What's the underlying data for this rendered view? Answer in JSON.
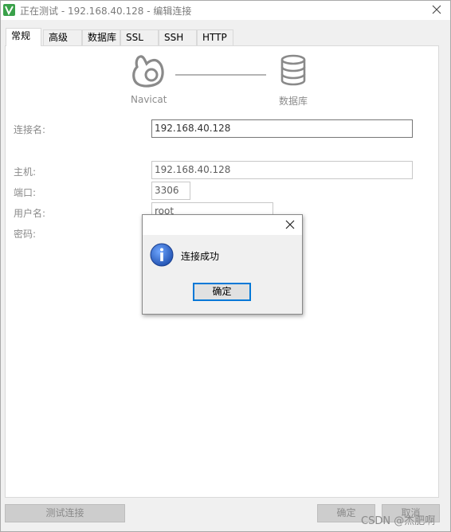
{
  "window": {
    "title": "正在测试 - 192.168.40.128 - 编辑连接"
  },
  "tabs": [
    {
      "label": "常规"
    },
    {
      "label": "高级"
    },
    {
      "label": "数据库"
    },
    {
      "label": "SSL"
    },
    {
      "label": "SSH"
    },
    {
      "label": "HTTP"
    }
  ],
  "header": {
    "navicat_label": "Navicat",
    "db_label": "数据库"
  },
  "form": {
    "connection_name_label": "连接名:",
    "connection_name_value": "192.168.40.128",
    "host_label": "主机:",
    "host_value": "192.168.40.128",
    "port_label": "端口:",
    "port_value": "3306",
    "username_label": "用户名:",
    "username_value": "root",
    "password_label": "密码:"
  },
  "footer": {
    "test_button": "测试连接",
    "ok_button": "确定",
    "cancel_button": "取消"
  },
  "dialog": {
    "message": "连接成功",
    "ok_button": "确定"
  },
  "watermark": "CSDN @杰肥啊",
  "colors": {
    "accent_focus": "#0078d7",
    "app_icon_green": "#3aa14a",
    "info_icon_blue": "#1f5fc2"
  }
}
